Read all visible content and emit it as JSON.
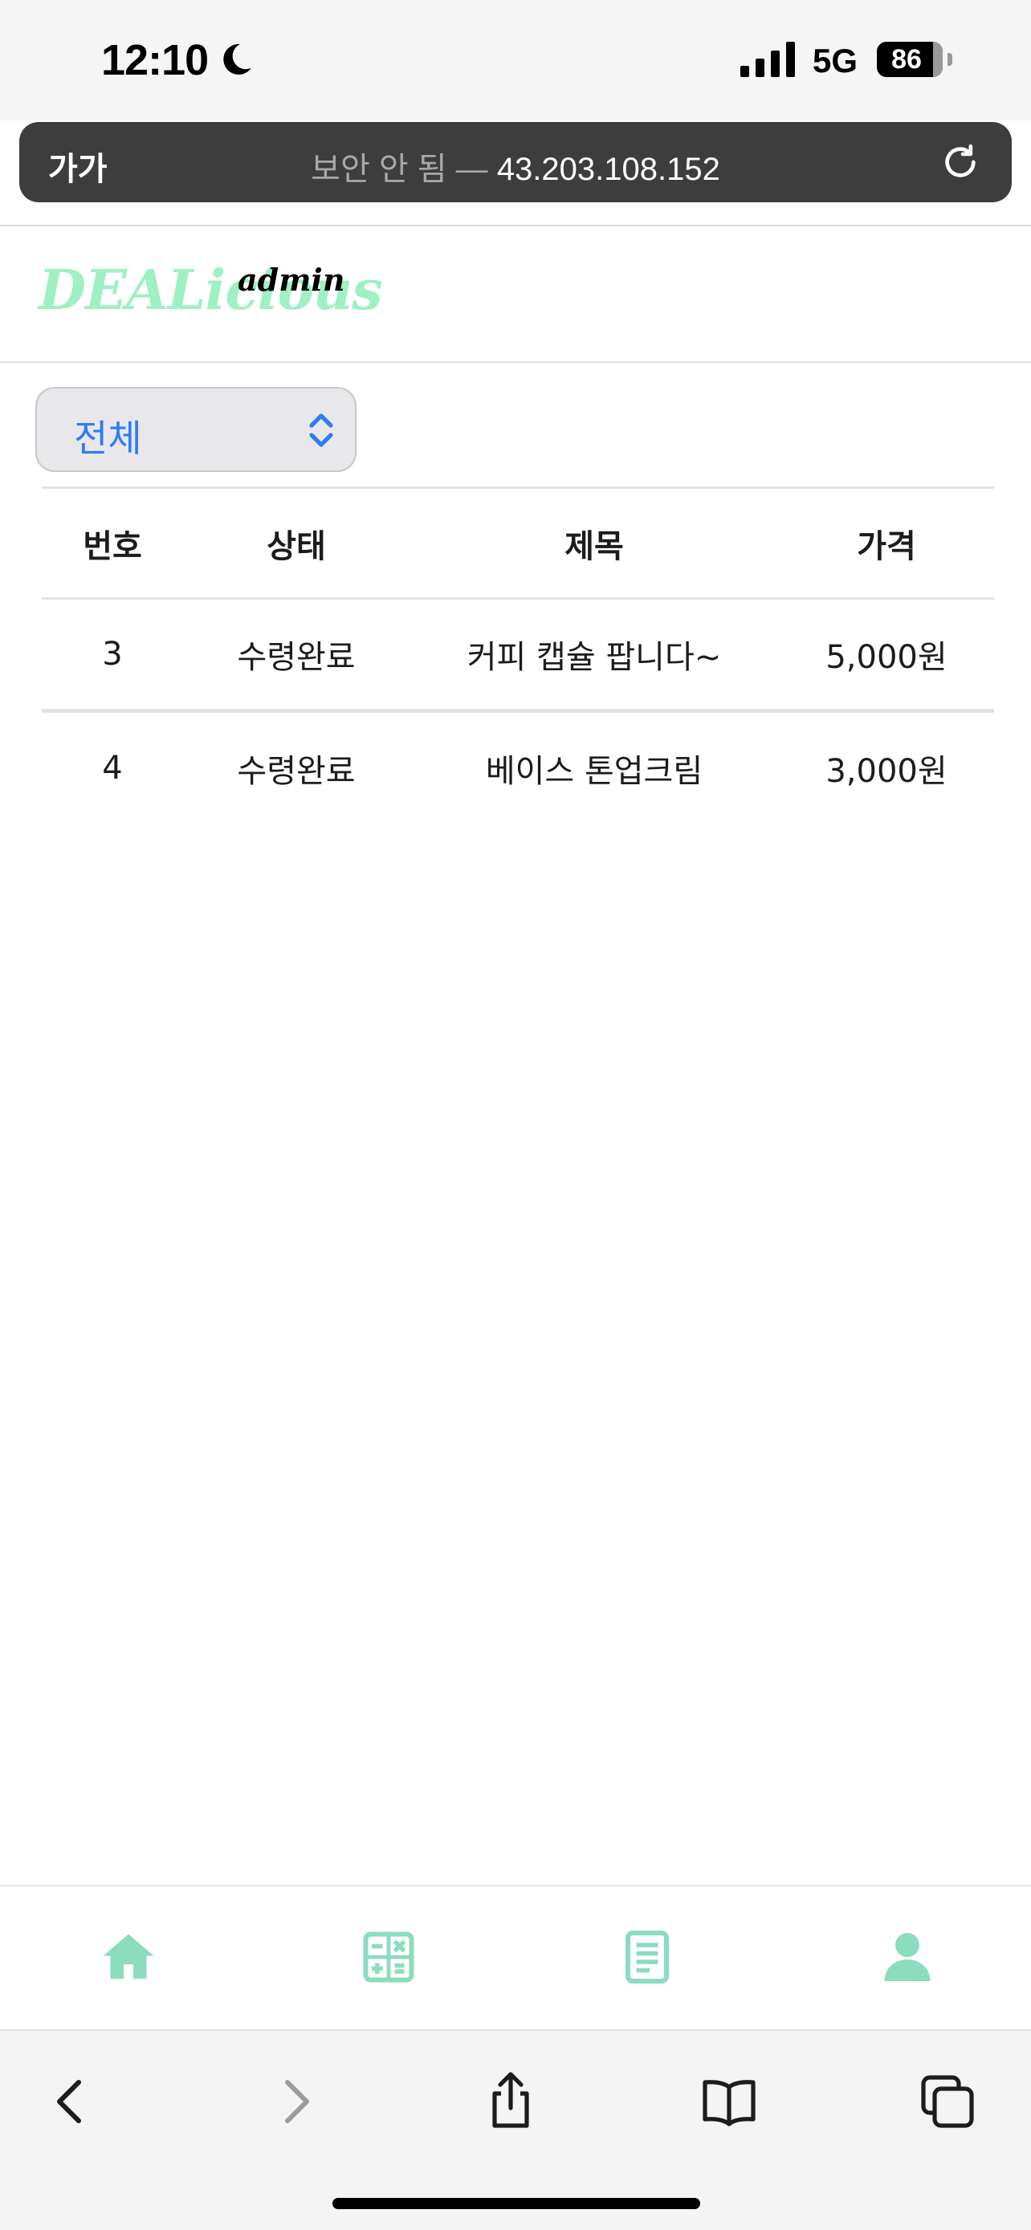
{
  "status_bar": {
    "time": "12:10",
    "network": "5G",
    "battery": "86",
    "icons": [
      "moon-icon",
      "signal-icon",
      "battery-icon"
    ]
  },
  "address_bar": {
    "reader_label": "가가",
    "security_label": "보안 안 됨 —",
    "host": "43.203.108.152",
    "icons": [
      "reload-icon"
    ]
  },
  "header": {
    "logo_main": "DEALicious",
    "logo_badge": "admin",
    "logo_color": "#9ff0c2"
  },
  "filter": {
    "selected": "전체",
    "accent_color": "#2f7cf6"
  },
  "table": {
    "columns": [
      "번호",
      "상태",
      "제목",
      "가격"
    ],
    "rows": [
      [
        "3",
        "수령완료",
        "커피 캡슐 팝니다~",
        "5,000원"
      ],
      [
        "4",
        "수령완료",
        "베이스 톤업크림",
        "3,000원"
      ]
    ]
  },
  "bottom_nav": {
    "icon_color": "#8cdcbe",
    "items": [
      "home-icon",
      "calculator-icon",
      "document-icon",
      "user-icon"
    ]
  },
  "safari_toolbar": {
    "items": [
      "back-icon",
      "forward-icon",
      "share-icon",
      "bookmarks-icon",
      "tabs-icon"
    ]
  }
}
